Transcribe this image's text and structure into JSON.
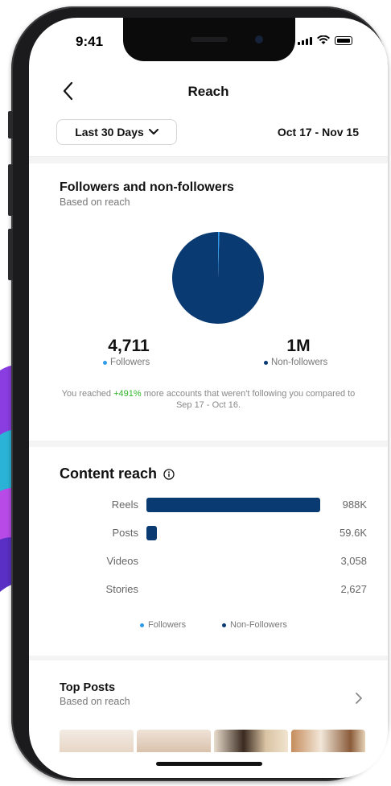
{
  "status": {
    "time": "9:41"
  },
  "nav": {
    "title": "Reach"
  },
  "filter": {
    "range_label": "Last 30 Days",
    "date_range": "Oct 17 - Nov 15"
  },
  "followers_section": {
    "title": "Followers and non-followers",
    "subtitle": "Based on reach",
    "followers_value": "4,711",
    "followers_label": "Followers",
    "non_followers_value": "1M",
    "non_followers_label": "Non-followers",
    "note_prefix": "You reached ",
    "note_highlight": "+491%",
    "note_suffix": " more accounts that weren't following you compared to Sep 17 - Oct 16.",
    "followers_color": "#2e9bea",
    "non_followers_color": "#0a3a72"
  },
  "chart_data": {
    "type": "pie",
    "slices": [
      {
        "label": "Followers",
        "value": 4711,
        "color": "#2e9bea"
      },
      {
        "label": "Non-followers",
        "value": 1000000,
        "color": "#0a3a72"
      }
    ]
  },
  "content_reach": {
    "title": "Content reach",
    "rows": [
      {
        "label": "Reels",
        "value": "988K",
        "num": 988000
      },
      {
        "label": "Posts",
        "value": "59.6K",
        "num": 59600
      },
      {
        "label": "Videos",
        "value": "3,058",
        "num": 3058
      },
      {
        "label": "Stories",
        "value": "2,627",
        "num": 2627
      }
    ],
    "legend_followers": "Followers",
    "legend_non_followers": "Non-Followers"
  },
  "top_posts": {
    "title": "Top Posts",
    "subtitle": "Based on reach"
  }
}
